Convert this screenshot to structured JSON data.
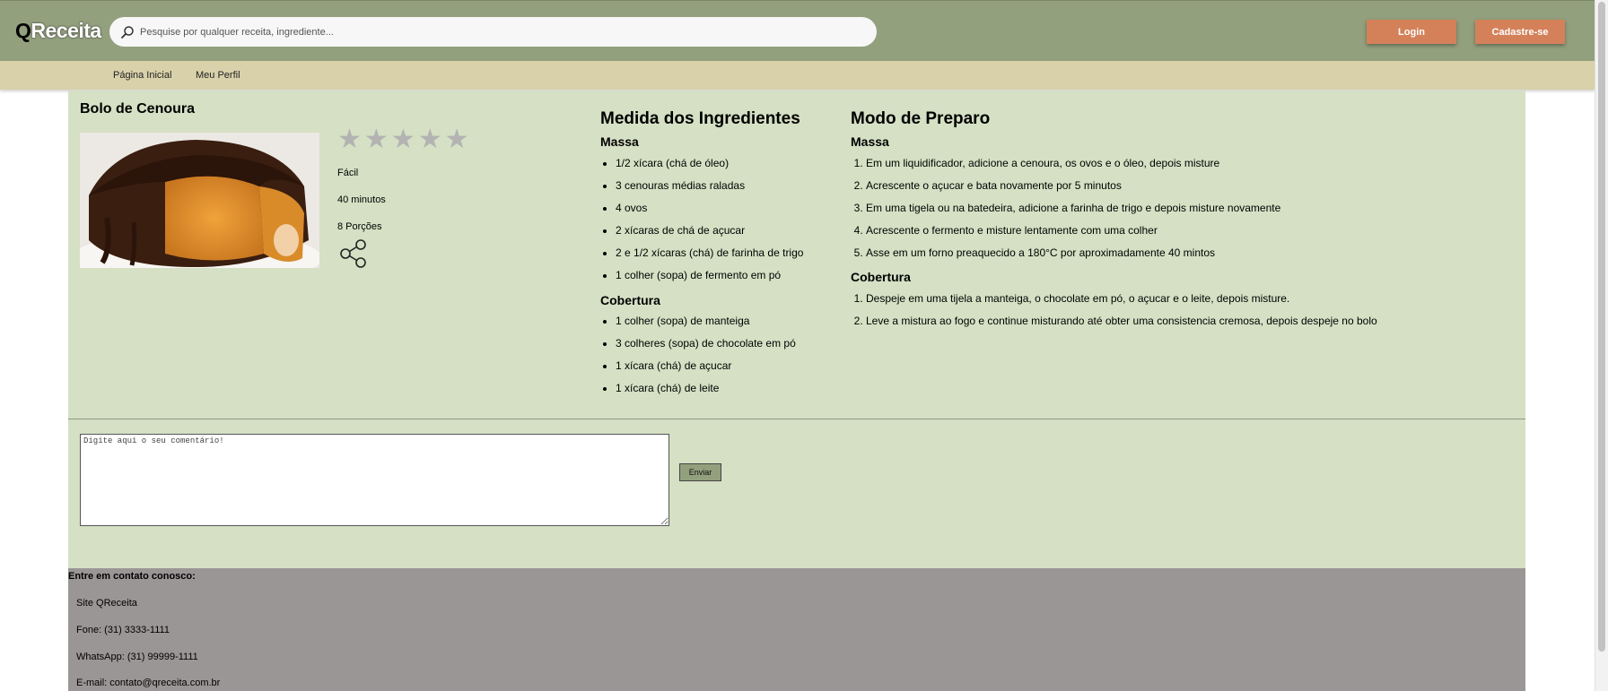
{
  "header": {
    "logo_q": "Q",
    "logo_rest": "Receita",
    "search_placeholder": "Pesquise por qualquer receita, ingrediente...",
    "login_label": "Login",
    "signup_label": "Cadastre-se"
  },
  "nav": {
    "items": [
      {
        "label": "Página Inicial"
      },
      {
        "label": "Meu Perfil"
      }
    ]
  },
  "recipe": {
    "title": "Bolo de Cenoura",
    "rating": {
      "value": 0,
      "max": 5
    },
    "difficulty": "Fácil",
    "time": "40 minutos",
    "servings": "8 Porções"
  },
  "ingredients": {
    "heading": "Medida dos Ingredientes",
    "massa_heading": "Massa",
    "massa": [
      "1/2 xícara (chá de óleo)",
      "3 cenouras médias raladas",
      "4 ovos",
      "2 xícaras de chá de açucar",
      "2 e 1/2 xícaras (chá) de farinha de trigo",
      "1 colher (sopa) de fermento em pó"
    ],
    "cobertura_heading": "Cobertura",
    "cobertura": [
      "1 colher (sopa) de manteiga",
      "3 colheres (sopa) de chocolate em pó",
      "1 xícara (chá) de açucar",
      "1 xícara (chá) de leite"
    ]
  },
  "preparation": {
    "heading": "Modo de Preparo",
    "massa_heading": "Massa",
    "massa": [
      "Em um liquidificador, adicione a cenoura, os ovos e o óleo, depois misture",
      "Acrescente o açucar e bata novamente por 5 minutos",
      "Em uma tigela ou na batedeira, adicione a farinha de trigo e depois misture novamente",
      "Acrescente o fermento e misture lentamente com uma colher",
      "Asse em um forno preaquecido a 180°C por aproximadamente 40 mintos"
    ],
    "cobertura_heading": "Cobertura",
    "cobertura": [
      "Despeje em uma tijela a manteiga, o chocolate em pó, o açucar e o leite, depois misture.",
      "Leve a mistura ao fogo e continue misturando até obter uma consistencia cremosa, depois despeje no bolo"
    ]
  },
  "comment": {
    "placeholder": "Digite aqui o seu comentário!",
    "send_label": "Enviar"
  },
  "footer": {
    "heading": "Entre em contato conosco:",
    "site": "Site QReceita",
    "phone": "Fone: (31) 3333-1111",
    "whatsapp": "WhatsApp: (31) 99999-1111",
    "email": "E-mail: contato@qreceita.com.br"
  },
  "colors": {
    "header_bg": "#93a07d",
    "nav_bg": "#d8d1aa",
    "main_bg": "#d5e0c4",
    "footer_bg": "#9b9696",
    "accent_button": "#d4815a",
    "star_inactive": "#b3b3b3"
  },
  "icons": {
    "search": "search-icon",
    "star": "star-icon",
    "share": "share-icon"
  }
}
